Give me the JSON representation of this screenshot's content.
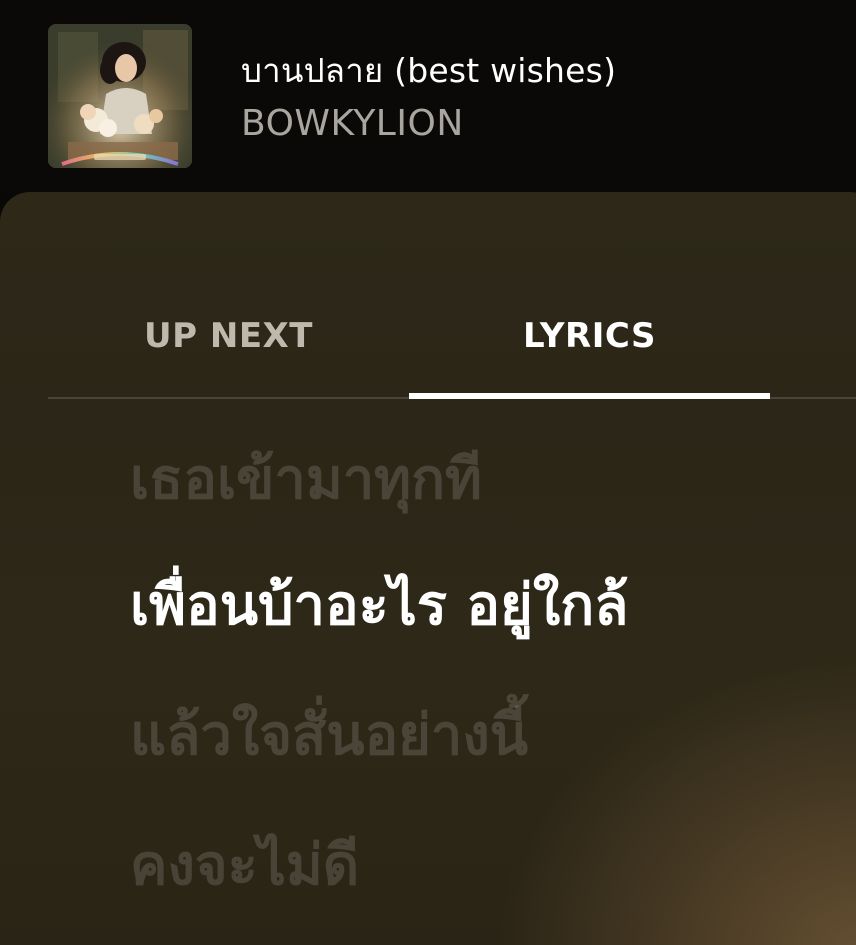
{
  "now_playing": {
    "title": "บานปลาย (best wishes)",
    "artist": "BOWKYLION",
    "album_art_icon": "album-cover-image"
  },
  "tabs": [
    {
      "label": "UP NEXT",
      "selected": false
    },
    {
      "label": "LYRICS",
      "selected": true
    }
  ],
  "lyrics": {
    "lines": [
      {
        "text": "เธอเข้ามาทุกที",
        "active": false
      },
      {
        "text": "เพื่อนบ้าอะไร อยู่ใกล้",
        "active": true
      },
      {
        "text": "แล้วใจสั่นอย่างนี้",
        "active": false
      },
      {
        "text": "คงจะไม่ดี",
        "active": false
      }
    ]
  },
  "colors": {
    "background": "#080806",
    "sheet": "#2d2818",
    "active_text": "#ffffff",
    "inactive_tab": "#bdb9ad",
    "artist_text": "#a8a69f"
  }
}
